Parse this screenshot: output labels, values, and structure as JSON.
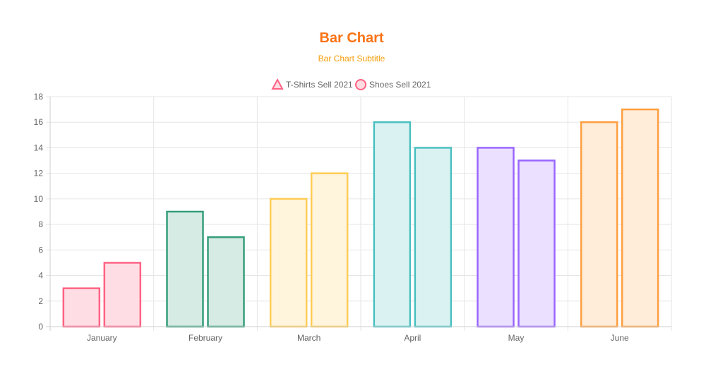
{
  "chart_data": {
    "type": "bar",
    "title": "Bar Chart",
    "subtitle": "Bar Chart Subtitle",
    "title_color": "#f97316",
    "subtitle_color": "#f59e0b",
    "categories": [
      "January",
      "February",
      "March",
      "April",
      "May",
      "June"
    ],
    "series": [
      {
        "name": "T-Shirts Sell 2021",
        "values": [
          3,
          9,
          10,
          16,
          14,
          16
        ]
      },
      {
        "name": "Shoes Sell 2021",
        "values": [
          5,
          7,
          12,
          14,
          13,
          17
        ]
      }
    ],
    "legend": {
      "placement": "top-center",
      "items": [
        {
          "label": "T-Shirts Sell 2021",
          "marker": "triangle"
        },
        {
          "label": "Shoes Sell 2021",
          "marker": "circle"
        }
      ],
      "marker_stroke": "#ff6384",
      "marker_fill": "#ffdbe2"
    },
    "category_colors": [
      {
        "stroke": "#ff6384",
        "fill": "#ffdde4"
      },
      {
        "stroke": "#359e7a",
        "fill": "#d6ebe3"
      },
      {
        "stroke": "#ffcd56",
        "fill": "#fff4dc"
      },
      {
        "stroke": "#4bc0c0",
        "fill": "#dbf2f2"
      },
      {
        "stroke": "#9966ff",
        "fill": "#ebe0ff"
      },
      {
        "stroke": "#ff9f40",
        "fill": "#ffecd9"
      }
    ],
    "ylim": [
      0,
      18
    ],
    "yticks": [
      0,
      2,
      4,
      6,
      8,
      10,
      12,
      14,
      16,
      18
    ],
    "grid": true,
    "xlabel": "",
    "ylabel": ""
  }
}
